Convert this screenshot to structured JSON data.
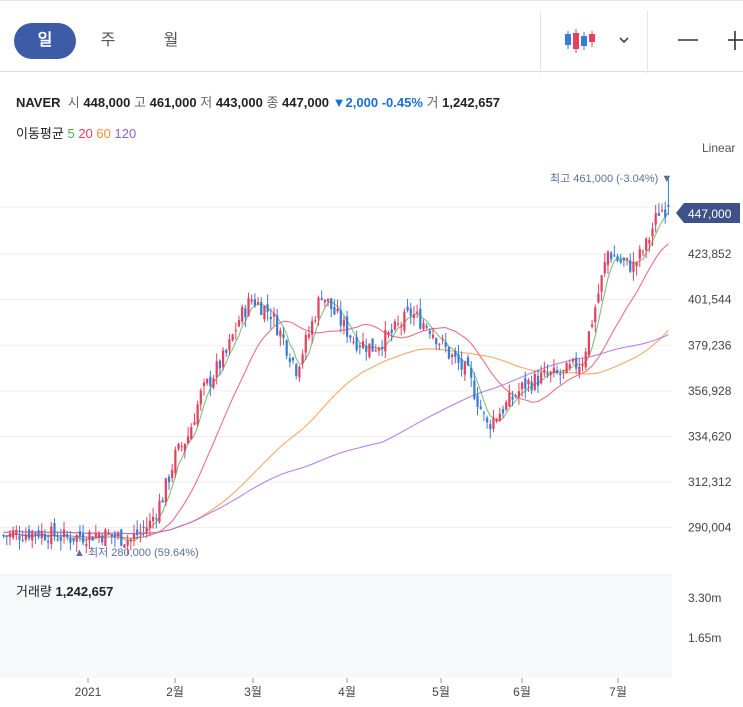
{
  "tabs": [
    {
      "label": "일",
      "active": true
    },
    {
      "label": "주",
      "active": false
    },
    {
      "label": "월",
      "active": false
    }
  ],
  "quote": {
    "name": "NAVER",
    "open_label": "시",
    "open": "448,000",
    "high_label": "고",
    "high": "461,000",
    "low_label": "저",
    "low": "443,000",
    "close_label": "종",
    "close": "447,000",
    "change": "▼2,000",
    "change_pct": "-0.45%",
    "volume_label": "거",
    "volume": "1,242,657"
  },
  "ma_legend": {
    "title": "이동평균",
    "items": [
      {
        "label": "5",
        "color": "#4caf50"
      },
      {
        "label": "20",
        "color": "#e5405e"
      },
      {
        "label": "60",
        "color": "#f08c38"
      },
      {
        "label": "120",
        "color": "#9d5be0"
      }
    ]
  },
  "scale_mode": "Linear",
  "annotations": {
    "max_label": "최고 461,000 (-3.04%) ▼",
    "min_label": "▲ 최저 280,000 (59.64%)"
  },
  "current_price_tag": "447,000",
  "volume_panel": {
    "title": "거래량",
    "value": "1,242,657",
    "ticks": [
      "3.30m",
      "1.65m"
    ]
  },
  "chart_data": {
    "type": "candlestick",
    "title": "NAVER",
    "ylim": [
      280000,
      466000
    ],
    "y_ticks": [
      423852,
      401544,
      379236,
      356928,
      334620,
      312312,
      290004
    ],
    "y_tick_labels": [
      "423,852",
      "401,544",
      "379,236",
      "356,928",
      "334,620",
      "312,312",
      "290,004"
    ],
    "x_labels": [
      "2021",
      "2월",
      "3월",
      "4월",
      "5월",
      "6월",
      "7월"
    ],
    "colors": {
      "up": "#e5405e",
      "down": "#3a7bd5",
      "up_vol": "#f0a3b0",
      "down_vol": "#9ec0ea"
    },
    "max": 461000,
    "min": 280000,
    "last_close": 447000,
    "volume_ylim": [
      0,
      3300000
    ],
    "price_path": [
      [
        0,
        286000
      ],
      [
        10,
        288000
      ],
      [
        20,
        285000
      ],
      [
        30,
        287000
      ],
      [
        40,
        284000
      ],
      [
        46,
        292000
      ],
      [
        50,
        305000
      ],
      [
        54,
        325000
      ],
      [
        58,
        335000
      ],
      [
        62,
        355000
      ],
      [
        66,
        365000
      ],
      [
        70,
        375000
      ],
      [
        74,
        392000
      ],
      [
        78,
        402000
      ],
      [
        84,
        395000
      ],
      [
        88,
        382000
      ],
      [
        92,
        368000
      ],
      [
        96,
        385000
      ],
      [
        100,
        405000
      ],
      [
        104,
        395000
      ],
      [
        110,
        382000
      ],
      [
        116,
        378000
      ],
      [
        122,
        385000
      ],
      [
        128,
        395000
      ],
      [
        134,
        388000
      ],
      [
        140,
        375000
      ],
      [
        146,
        365000
      ],
      [
        152,
        340000
      ],
      [
        158,
        350000
      ],
      [
        164,
        360000
      ],
      [
        170,
        364000
      ],
      [
        176,
        365000
      ],
      [
        182,
        372000
      ],
      [
        186,
        398000
      ],
      [
        190,
        425000
      ],
      [
        194,
        420000
      ],
      [
        198,
        418000
      ],
      [
        202,
        428000
      ],
      [
        206,
        445000
      ],
      [
        209,
        447000
      ]
    ]
  }
}
